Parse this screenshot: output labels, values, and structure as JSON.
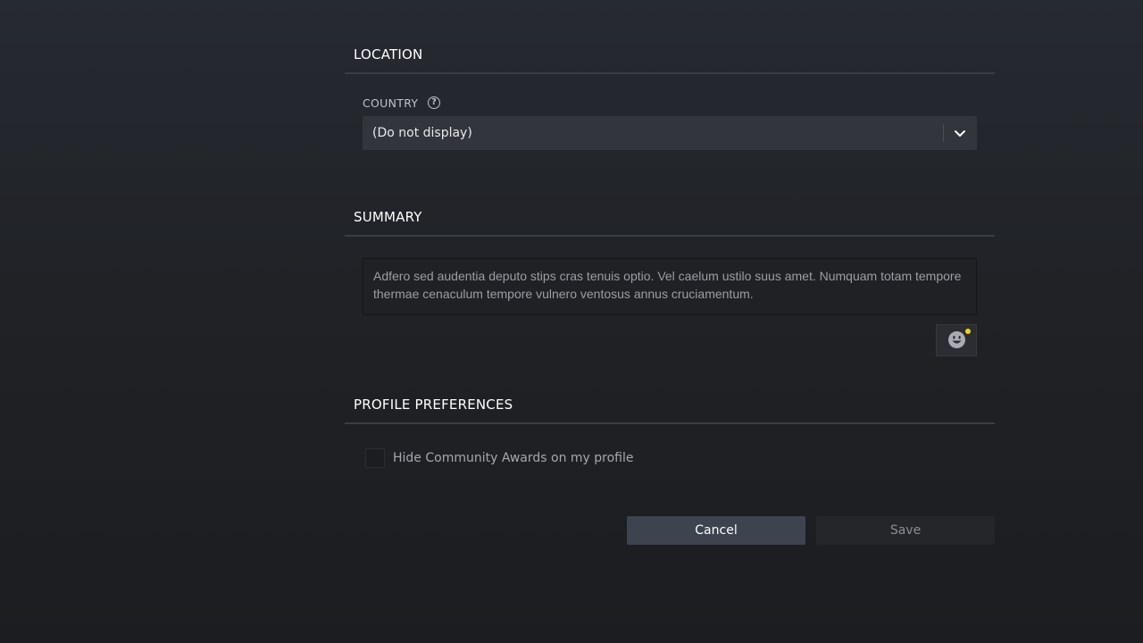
{
  "location": {
    "heading": "LOCATION",
    "country_label": "COUNTRY",
    "help_glyph": "?",
    "country_value": "(Do not display)"
  },
  "summary": {
    "heading": "SUMMARY",
    "text": "Adfero sed audentia deputo stips cras tenuis optio. Vel caelum ustilo suus amet. Numquam totam tempore thermae cenaculum tempore vulnero ventosus annus cruciamentum.",
    "emoji_icon": "smiley-face-icon",
    "notification_color": "#f2cf24"
  },
  "preferences": {
    "heading": "PROFILE PREFERENCES",
    "hide_awards_label": "Hide Community Awards on my profile",
    "hide_awards_checked": false
  },
  "actions": {
    "cancel_label": "Cancel",
    "save_label": "Save"
  },
  "colors": {
    "background": "#202226",
    "dropdown_bg": "#32353c",
    "cancel_bg": "#3d4450",
    "save_bg": "#24262a"
  }
}
